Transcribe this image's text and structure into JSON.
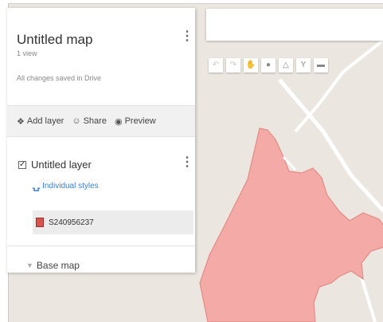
{
  "map": {
    "title": "Untitled map",
    "views": "1 view",
    "save_status": "All changes saved in Drive"
  },
  "actions": [
    {
      "icon": "add-layer-icon",
      "glyph": "❖",
      "label": "Add layer"
    },
    {
      "icon": "share-icon",
      "glyph": "☺",
      "label": "Share"
    },
    {
      "icon": "preview-icon",
      "glyph": "◉",
      "label": "Preview"
    }
  ],
  "layer": {
    "title": "Untitled layer",
    "checked": true,
    "style_label": "Individual styles",
    "feature_label": "S240956237"
  },
  "base_map": {
    "label": "Base map"
  },
  "toolbar": {
    "tools": [
      "undo-icon",
      "redo-icon",
      "hand-icon",
      "marker-icon",
      "draw-line-icon",
      "route-icon",
      "ruler-icon"
    ]
  },
  "colors": {
    "polygon_fill": "#f4aaa6",
    "polygon_stroke": "#e58a85",
    "road": "#ffffff",
    "map_background": "#ebe7e0",
    "link_blue": "#3d7fce"
  }
}
